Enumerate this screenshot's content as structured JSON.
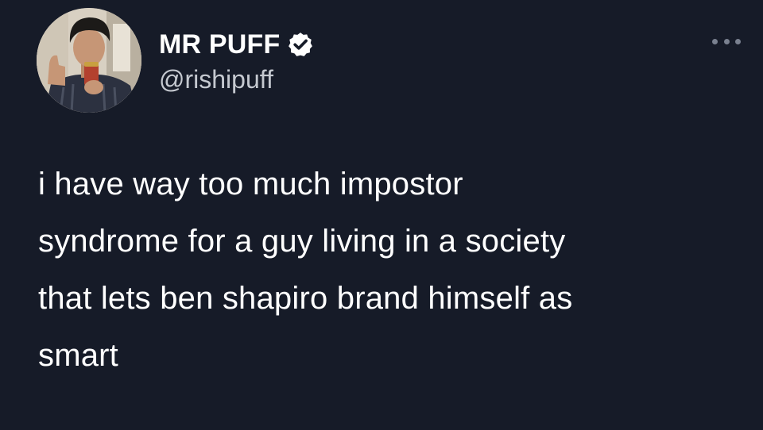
{
  "author": {
    "display_name": "MR PUFF",
    "handle": "@rishipuff",
    "verified": true
  },
  "tweet": {
    "text": "i have way too much impostor\nsyndrome for a guy living in a society\nthat lets ben shapiro brand himself as\nsmart"
  },
  "icons": {
    "verified": "verified-badge-icon",
    "more": "more-options-icon"
  },
  "colors": {
    "background": "#161b28",
    "text": "#ffffff",
    "handle": "#c5c9d0"
  }
}
